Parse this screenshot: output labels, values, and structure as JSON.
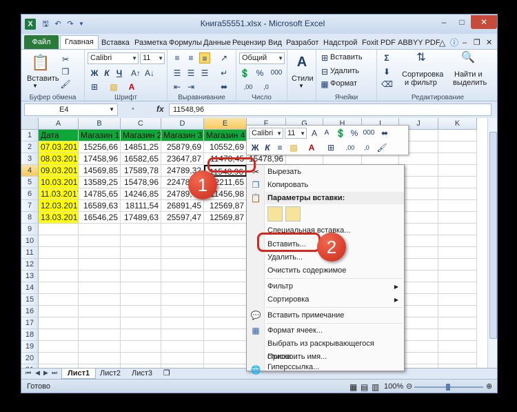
{
  "window": {
    "title": "Книга55551.xlsx - Microsoft Excel"
  },
  "tabs": [
    "Файл",
    "Главная",
    "Вставка",
    "Разметка",
    "Формулы",
    "Данные",
    "Рецензир",
    "Вид",
    "Разработ",
    "Надстрой",
    "Foxit PDF",
    "ABBYY PDF"
  ],
  "ribbon": {
    "clipboard": {
      "paste": "Вставить",
      "label": "Буфер обмена"
    },
    "font": {
      "name": "Calibri",
      "size": "11",
      "bold": "Ж",
      "italic": "К",
      "underline": "Ч",
      "label": "Шрифт"
    },
    "alignment": {
      "label": "Выравнивание"
    },
    "number": {
      "format": "Общий",
      "label": "Число"
    },
    "styles": {
      "label": "Стили"
    },
    "cells": {
      "insert": "Вставить",
      "delete": "Удалить",
      "format": "Формат",
      "label": "Ячейки"
    },
    "editing": {
      "sort": "Сортировка",
      "sort2": "и фильтр",
      "find": "Найти и",
      "find2": "выделить",
      "label": "Редактирование"
    }
  },
  "formula_bar": {
    "cell_ref": "E4",
    "fx": "fx",
    "value": "11548,96"
  },
  "grid": {
    "columns": [
      "A",
      "B",
      "C",
      "D",
      "E",
      "F",
      "G",
      "H",
      "I",
      "J",
      "K"
    ],
    "rows": [
      "1",
      "2",
      "3",
      "4",
      "5",
      "6",
      "7",
      "8",
      "9",
      "10",
      "11",
      "12",
      "13",
      "14",
      "15",
      "16",
      "17",
      "18",
      "19",
      "20",
      "21"
    ],
    "header": [
      "Дата",
      "Магазин 1",
      "Магазин 2",
      "Магазин 3",
      "Магазин 4"
    ],
    "data": [
      [
        "07.03.2017",
        "15256,66",
        "14851,25",
        "25879,69",
        "10552,69"
      ],
      [
        "08.03.2017",
        "17458,96",
        "16582,65",
        "23647,87",
        "11478,45"
      ],
      [
        "09.03.2017",
        "14569,85",
        "17589,78",
        "24789,32",
        "11548,96"
      ],
      [
        "10.03.2017",
        "13589,25",
        "15478,96",
        "22478,96",
        "12211,65"
      ],
      [
        "11.03.2017",
        "14785,65",
        "14246,85",
        "24789,45",
        "11456,98"
      ],
      [
        "12.03.2017",
        "16589,63",
        "18111,54",
        "26891,45",
        "12569,87"
      ],
      [
        "13.03.2017",
        "16546,25",
        "17489,63",
        "25597,47",
        "12569,87"
      ]
    ],
    "f_partial": "15478,96"
  },
  "sheets": [
    "Лист1",
    "Лист2",
    "Лист3"
  ],
  "status": {
    "ready": "Готово",
    "zoom": "100%"
  },
  "mini_toolbar": {
    "font": "Calibri",
    "size": "11"
  },
  "context_menu": {
    "cut": "Вырезать",
    "copy": "Копировать",
    "paste_header": "Параметры вставки:",
    "paste_special": "Специальная вставка...",
    "insert": "Вставить...",
    "delete": "Удалить...",
    "clear": "Очистить содержимое",
    "filter": "Фильтр",
    "sort": "Сортировка",
    "add_comment": "Вставить примечание",
    "format_cells": "Формат ячеек...",
    "pick_list": "Выбрать из раскрывающегося списка...",
    "name": "Присвоить имя...",
    "hyperlink": "Гиперссылка..."
  },
  "callouts": [
    "1",
    "2"
  ],
  "colors": {
    "header_green": "#0fa63a",
    "date_yellow": "#ffff00",
    "callout_red": "#d8261f"
  }
}
